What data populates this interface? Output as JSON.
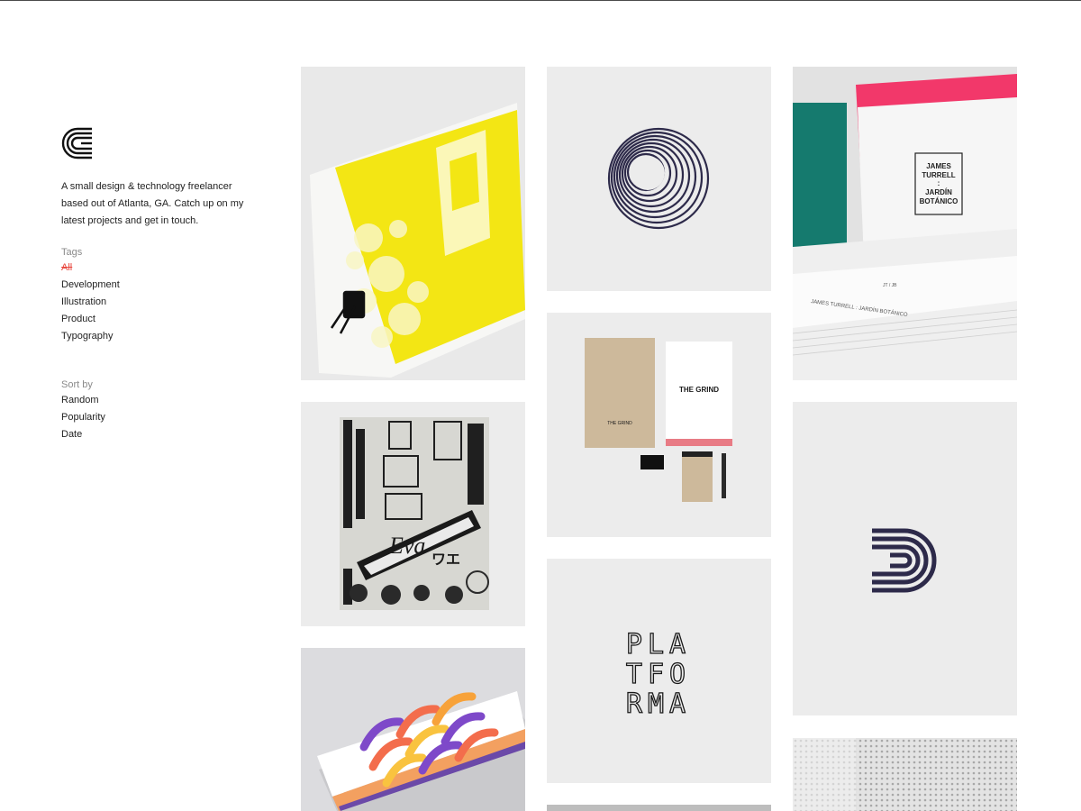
{
  "brand": {
    "logo_icon": "stacked-c-logo-icon"
  },
  "sidebar": {
    "intro": "A small design & technology freelancer based out of Atlanta, GA. Catch up on my latest projects and get in touch.",
    "tags": {
      "label": "Tags",
      "items": [
        "All",
        "Development",
        "Illustration",
        "Product",
        "Typography"
      ],
      "active": "All"
    },
    "sort": {
      "label": "Sort by",
      "items": [
        "Random",
        "Popularity",
        "Date"
      ]
    }
  },
  "tiles": {
    "turrell": {
      "title_line1": "JAMES",
      "title_line2": "TURRELL",
      "title_sep": ":",
      "title_line3": "JARDÍN",
      "title_line4": "BOTÁNICO",
      "spine": "JAMES TURRELL : JARDÍN BOTÁNICO",
      "code": "JT / JB"
    },
    "grind": {
      "brand_large": "THE GRIND",
      "brand_small": "THE GRIND"
    },
    "platforma": {
      "row1": "PLA",
      "row2": "TFO",
      "row3": "RMA"
    },
    "eva": {
      "headline": "Eva",
      "katakana": "ワエ"
    }
  },
  "colors": {
    "accent": "#e8453c",
    "tile_bg": "#ececec",
    "navy": "#2d2a4a",
    "yellow": "#f3e614",
    "pink": "#f2386a",
    "teal": "#157a6e"
  }
}
